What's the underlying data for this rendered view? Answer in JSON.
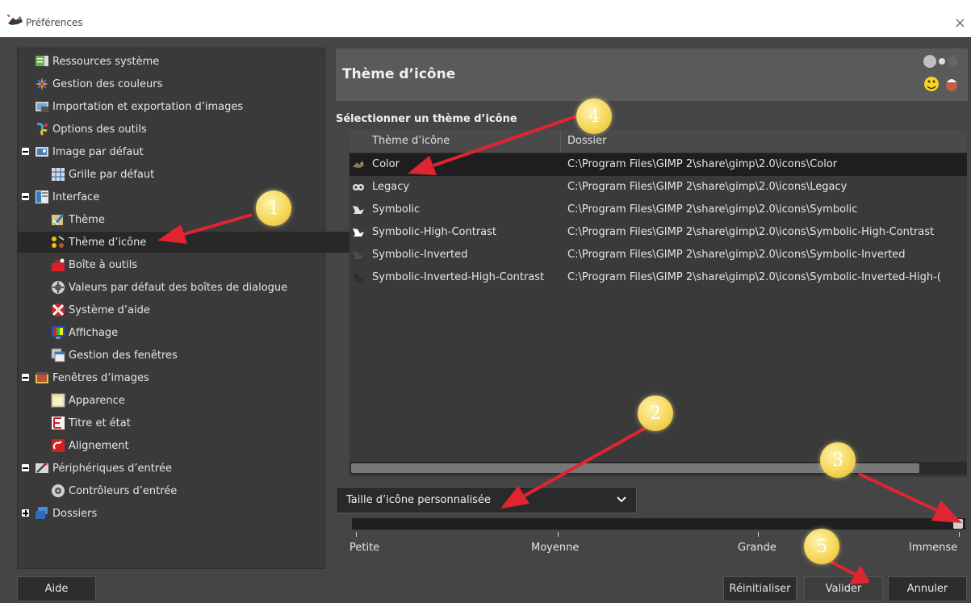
{
  "window": {
    "title": "Préférences",
    "close_glyph": "×"
  },
  "sidebar": {
    "items": [
      {
        "label": "Ressources système",
        "icon": "system-resources-icon"
      },
      {
        "label": "Gestion des couleurs",
        "icon": "color-management-icon"
      },
      {
        "label": "Importation et exportation d’images",
        "icon": "image-import-export-icon"
      },
      {
        "label": "Options des outils",
        "icon": "tool-options-icon"
      },
      {
        "label": "Image par défaut",
        "icon": "default-image-icon"
      },
      {
        "label": "Grille par défaut",
        "icon": "default-grid-icon"
      },
      {
        "label": "Interface",
        "icon": "interface-icon"
      },
      {
        "label": "Thème",
        "icon": "theme-icon"
      },
      {
        "label": "Thème d’icône",
        "icon": "icon-theme-icon"
      },
      {
        "label": "Boîte à outils",
        "icon": "toolbox-icon"
      },
      {
        "label": "Valeurs par défaut des boîtes de dialogue",
        "icon": "dialog-defaults-icon"
      },
      {
        "label": "Système d’aide",
        "icon": "help-system-icon"
      },
      {
        "label": "Affichage",
        "icon": "display-icon"
      },
      {
        "label": "Gestion des fenêtres",
        "icon": "window-management-icon"
      },
      {
        "label": "Fenêtres d’images",
        "icon": "image-windows-icon"
      },
      {
        "label": "Apparence",
        "icon": "appearance-icon"
      },
      {
        "label": "Titre et état",
        "icon": "title-status-icon"
      },
      {
        "label": "Alignement",
        "icon": "snapping-icon"
      },
      {
        "label": "Périphériques d’entrée",
        "icon": "input-devices-icon"
      },
      {
        "label": "Contrôleurs d’entrée",
        "icon": "input-controllers-icon"
      },
      {
        "label": "Dossiers",
        "icon": "folders-icon"
      }
    ]
  },
  "panel": {
    "title": "Thème d’icône",
    "section_label": "Sélectionner un thème d’icône",
    "columns": [
      "Thème d’icône",
      "Dossier"
    ],
    "rows": [
      {
        "name": "Color",
        "folder": "C:\\Program Files\\GIMP 2\\share\\gimp\\2.0\\icons\\Color"
      },
      {
        "name": "Legacy",
        "folder": "C:\\Program Files\\GIMP 2\\share\\gimp\\2.0\\icons\\Legacy"
      },
      {
        "name": "Symbolic",
        "folder": "C:\\Program Files\\GIMP 2\\share\\gimp\\2.0\\icons\\Symbolic"
      },
      {
        "name": "Symbolic-High-Contrast",
        "folder": "C:\\Program Files\\GIMP 2\\share\\gimp\\2.0\\icons\\Symbolic-High-Contrast"
      },
      {
        "name": "Symbolic-Inverted",
        "folder": "C:\\Program Files\\GIMP 2\\share\\gimp\\2.0\\icons\\Symbolic-Inverted"
      },
      {
        "name": "Symbolic-Inverted-High-Contrast",
        "folder": "C:\\Program Files\\GIMP 2\\share\\gimp\\2.0\\icons\\Symbolic-Inverted-High-("
      }
    ],
    "selected_row": "Color",
    "size_combo": "Taille d’icône personnalisée",
    "size_marks": [
      "Petite",
      "Moyenne",
      "Grande",
      "Immense"
    ],
    "size_value": 1.0
  },
  "buttons": {
    "help": "Aide",
    "reset": "Réinitialiser",
    "ok": "Valider",
    "cancel": "Annuler"
  },
  "annotations": [
    "1",
    "2",
    "3",
    "4",
    "5"
  ],
  "colors": {
    "window_bg": "#454545",
    "selection": "#282828",
    "callout": "#f5d75a",
    "arrow": "#e02530"
  }
}
